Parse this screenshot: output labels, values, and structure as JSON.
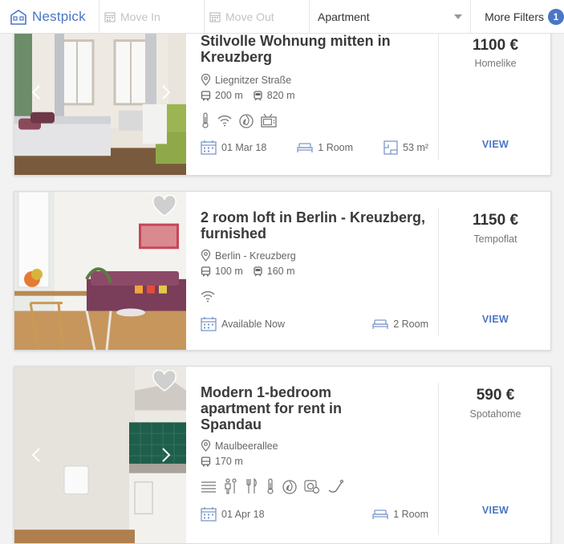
{
  "header": {
    "logo_text": "Nestpick",
    "move_in_placeholder": "Move In",
    "move_out_placeholder": "Move Out",
    "type_selected": "Apartment",
    "more_filters_label": "More Filters",
    "filter_count": "1"
  },
  "listings": [
    {
      "title": "Stilvolle Wohnung mitten in Kreuzberg",
      "street": "Liegnitzer Straße",
      "bus_distance": "200 m",
      "train_distance": "820 m",
      "amenities": [
        "heating-icon",
        "wifi-icon",
        "gas-icon",
        "tv-icon"
      ],
      "date": "01 Mar 18",
      "rooms": "1 Room",
      "size": "53 m²",
      "price": "1100 €",
      "provider": "Homelike",
      "view_label": "VIEW"
    },
    {
      "title": "2 room loft in Berlin - Kreuzberg, furnished",
      "street": "Berlin - Kreuzberg",
      "bus_distance": "100 m",
      "train_distance": "160 m",
      "amenities": [
        "wifi-icon"
      ],
      "date": "Available Now",
      "rooms": "2 Room",
      "price": "1150 €",
      "provider": "Tempoflat",
      "view_label": "VIEW"
    },
    {
      "title": "Modern 1-bedroom apartment for rent in Spandau",
      "street": "Maulbeerallee",
      "bus_distance": "170 m",
      "amenities": [
        "radiator-icon",
        "bathroom-icon",
        "kitchen-icon",
        "heating-icon",
        "gas-icon",
        "washer-icon",
        "smoking-icon"
      ],
      "date": "01 Apr 18",
      "rooms": "1 Room",
      "price": "590 €",
      "provider": "Spotahome",
      "view_label": "VIEW"
    }
  ]
}
